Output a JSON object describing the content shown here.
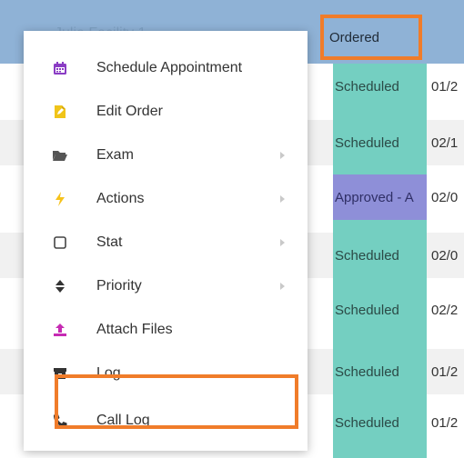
{
  "table": {
    "header_status": "Ordered",
    "header_faint": "Julie Facility 1",
    "rows": [
      {
        "status": "Scheduled",
        "date": "01/2"
      },
      {
        "status": "Scheduled",
        "date": "02/1"
      },
      {
        "status": "Approved - A",
        "date": "02/0"
      },
      {
        "status": "Scheduled",
        "date": "02/0"
      },
      {
        "status": "Scheduled",
        "date": "02/2"
      },
      {
        "status": "Scheduled",
        "date": "01/2"
      },
      {
        "status": "Scheduled",
        "date": "01/2"
      }
    ]
  },
  "menu": {
    "items": [
      {
        "label": "Schedule Appointment",
        "icon": "calendar-icon",
        "submenu": false
      },
      {
        "label": "Edit Order",
        "icon": "edit-document-icon",
        "submenu": false
      },
      {
        "label": "Exam",
        "icon": "folder-open-icon",
        "submenu": true
      },
      {
        "label": "Actions",
        "icon": "lightning-bolt-icon",
        "submenu": true
      },
      {
        "label": "Stat",
        "icon": "checkbox-icon",
        "submenu": true
      },
      {
        "label": "Priority",
        "icon": "sort-icon",
        "submenu": true
      },
      {
        "label": "Attach Files",
        "icon": "upload-icon",
        "submenu": false
      },
      {
        "label": "Log",
        "icon": "archive-icon",
        "submenu": false
      },
      {
        "label": "Call Log",
        "icon": "phone-icon",
        "submenu": false
      }
    ]
  },
  "colors": {
    "header_bg": "#8fb2d6",
    "scheduled_bg": "#74cfc1",
    "approved_bg": "#8e8fd8",
    "highlight_border": "#f07c2a",
    "calendar_icon": "#8a3cc4",
    "edit_icon": "#f0c419",
    "actions_icon": "#f6c21b",
    "attach_icon": "#c62bb3"
  }
}
